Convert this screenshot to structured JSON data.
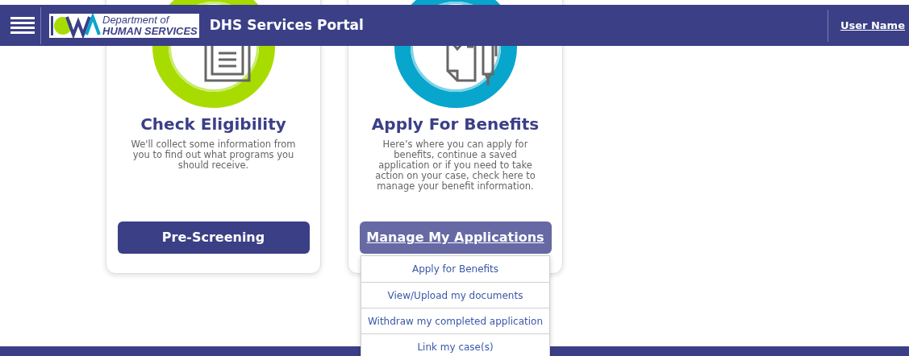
{
  "header": {
    "logo_line_1": "Department of",
    "logo_line_2": "HUMAN SERVICES",
    "title": "DHS Services Portal",
    "user": "User Name"
  },
  "cards": [
    {
      "kind": "eligibility",
      "title": "Check Eligibility",
      "description": "We'll collect some information from you to find out what programs you should receive.",
      "button": "Pre-Screening",
      "expanded": false
    },
    {
      "kind": "benefits",
      "title": "Apply For Benefits",
      "description": "Here’s where you can apply for benefits, continue a saved application or if you need to take action on your case, check here to manage your benefit information.",
      "button": "Manage My Applications",
      "expanded": true,
      "menu": [
        "Apply for Benefits",
        "View/Upload my documents",
        "Withdraw my completed application",
        "Link my case(s)"
      ]
    }
  ]
}
